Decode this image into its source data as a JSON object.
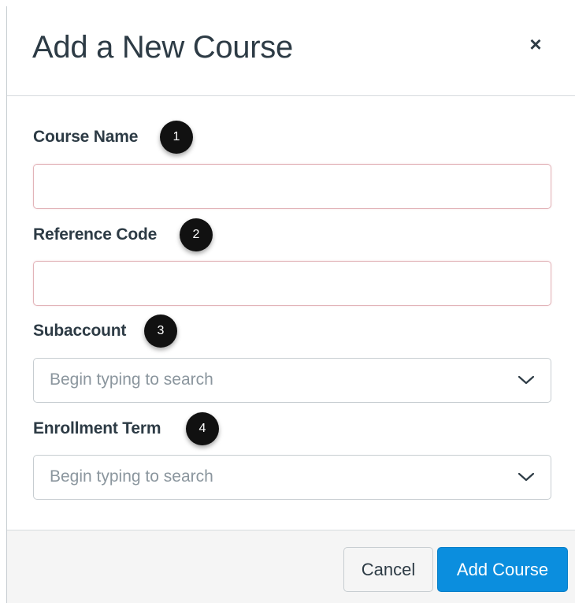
{
  "dialog": {
    "title": "Add a New Course",
    "close_glyph": "×"
  },
  "fields": {
    "course_name": {
      "label": "Course Name",
      "value": "",
      "callout": "1"
    },
    "reference_code": {
      "label": "Reference Code",
      "value": "",
      "callout": "2"
    },
    "subaccount": {
      "label": "Subaccount",
      "placeholder": "Begin typing to search",
      "callout": "3"
    },
    "enrollment_term": {
      "label": "Enrollment Term",
      "placeholder": "Begin typing to search",
      "callout": "4"
    }
  },
  "footer": {
    "cancel_label": "Cancel",
    "add_label": "Add Course"
  },
  "colors": {
    "primary": "#0b8ede",
    "text": "#2d3b45",
    "invalid_border": "#e2b4b9",
    "footer_bg": "#f5f5f5"
  },
  "icons": {
    "close": "close-icon",
    "dropdown": "chevron-down-icon"
  }
}
